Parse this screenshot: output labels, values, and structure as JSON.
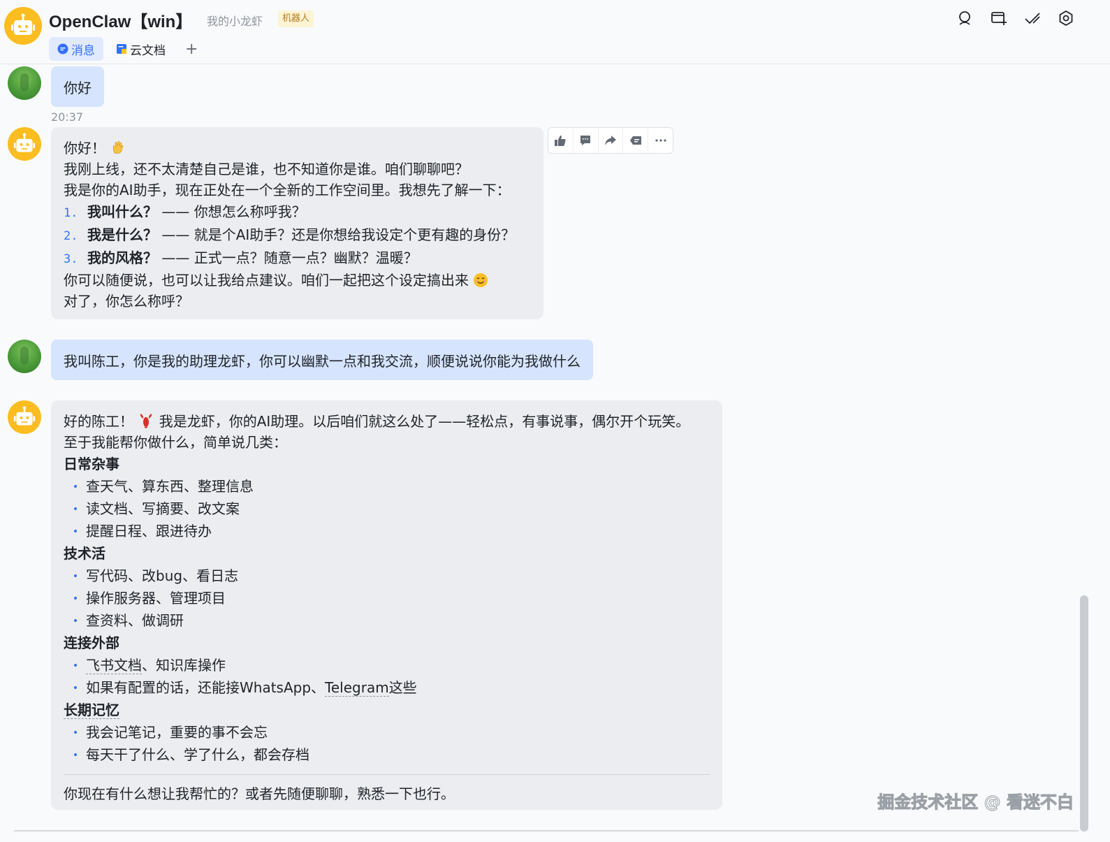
{
  "header": {
    "title": "OpenClaw【win】",
    "subtitle": "我的小龙虾",
    "badge": "机器人",
    "actions": [
      "search-icon",
      "add-window-icon",
      "check-edit-icon",
      "gear-icon"
    ]
  },
  "tabs": [
    {
      "label": "消息",
      "icon": "message-icon",
      "active": true
    },
    {
      "label": "云文档",
      "icon": "doc-icon",
      "active": false
    }
  ],
  "tab_add_label": "+",
  "messages": {
    "m1": {
      "text": "你好",
      "time": "20:37"
    },
    "m2": {
      "greeting": "你好！",
      "line1": "我刚上线，还不太清楚自己是谁，也不知道你是谁。咱们聊聊吧？",
      "line2": "我是你的AI助手，现在正处在一个全新的工作空间里。我想先了解一下：",
      "items": [
        {
          "num": "1.",
          "bold": "我叫什么？",
          "rest": "—— 你想怎么称呼我？"
        },
        {
          "num": "2.",
          "bold": "我是什么？",
          "rest": "—— 就是个AI助手？还是你想给我设定个更有趣的身份？"
        },
        {
          "num": "3.",
          "bold": "我的风格？",
          "rest": "—— 正式一点？随意一点？幽默？温暖？"
        }
      ],
      "line3": "你可以随便说，也可以让我给点建议。咱们一起把这个设定搞出来",
      "line4": "对了，你怎么称呼？"
    },
    "m3": {
      "text": "我叫陈工，你是我的助理龙虾，你可以幽默一点和我交流，顺便说说你能为我做什么"
    },
    "m4": {
      "intro_a": "好的陈工！",
      "intro_b": "我是龙虾，你的AI助理。以后咱们就这么处了——轻松点，有事说事，偶尔开个玩笑。",
      "intro2": "至于我能帮你做什么，简单说几类：",
      "sections": [
        {
          "heading": "日常杂事",
          "items": [
            "查天气、算东西、整理信息",
            "读文档、写摘要、改文案",
            "提醒日程、跟进待办"
          ]
        },
        {
          "heading": "技术活",
          "items": [
            "写代码、改bug、看日志",
            "操作服务器、管理项目",
            "查资料、做调研"
          ]
        },
        {
          "heading": "连接外部",
          "items": [
            "飞书文档、知识库操作",
            "如果有配置的话，还能接WhatsApp、Telegram这些"
          ]
        },
        {
          "heading": "长期记忆",
          "items": [
            "我会记笔记，重要的事不会忘",
            "每天干了什么、学了什么，都会存档"
          ]
        }
      ],
      "s3_item1_a": "飞书文档",
      "s3_item1_b": "、知识库操作",
      "s3_item2_a": "如果有配置的话，还能接WhatsApp、",
      "s3_item2_b": "Telegram",
      "s3_item2_c": "这些",
      "closing": "你现在有什么想让我帮忙的？或者先随便聊聊，熟悉一下也行。"
    }
  },
  "message_toolbar": [
    "thumbs-up-icon",
    "comment-icon",
    "forward-icon",
    "reply-icon",
    "more-icon"
  ],
  "watermark": "掘金技术社区 @ 看迷不白"
}
